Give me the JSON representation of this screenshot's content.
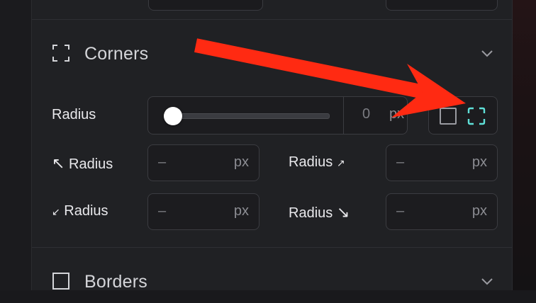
{
  "corners_section": {
    "title": "Corners",
    "icon": "corners-icon",
    "radius_label": "Radius",
    "radius_value": "0",
    "radius_unit": "px",
    "radius_slider_level": 0,
    "mode_toggle": {
      "uniform_icon": "square-icon",
      "individual_icon": "individual-corners-icon",
      "active": "individual"
    },
    "corner_fields": [
      {
        "arrow": "↖",
        "label": "Radius",
        "arrow_position": "before",
        "value": "–",
        "unit": "px"
      },
      {
        "arrow": "↗",
        "label": "Radius",
        "arrow_position": "after",
        "value": "–",
        "unit": "px"
      },
      {
        "arrow": "↙",
        "label": "Radius",
        "arrow_position": "before",
        "value": "–",
        "unit": "px"
      },
      {
        "arrow": "↘",
        "label": "Radius",
        "arrow_position": "after",
        "value": "–",
        "unit": "px"
      }
    ]
  },
  "borders_section": {
    "title": "Borders",
    "icon": "square-icon"
  },
  "colors": {
    "panel_bg": "#202124",
    "field_border": "#3b3c41",
    "accent_teal": "#5fe0d8",
    "annotation_red": "#ff2a12"
  }
}
